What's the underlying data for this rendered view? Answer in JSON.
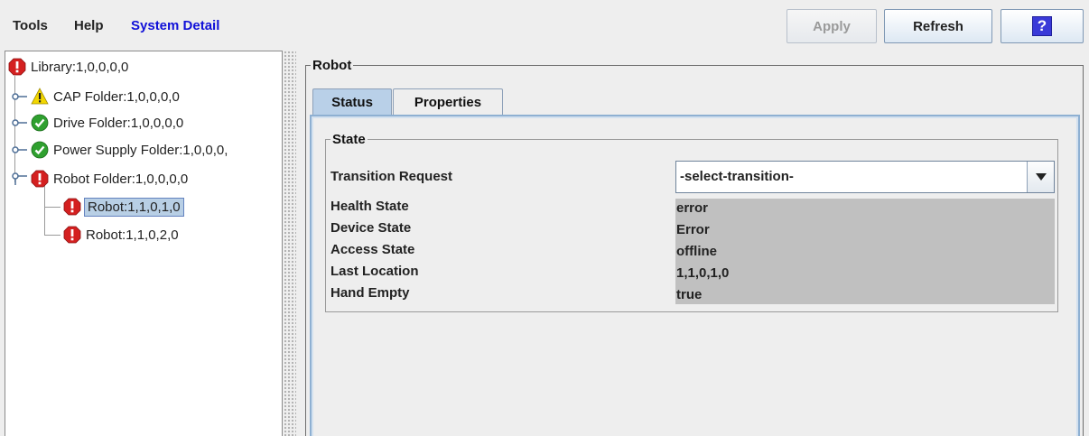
{
  "menu": {
    "tools": "Tools",
    "help": "Help",
    "system_detail": "System Detail"
  },
  "toolbar": {
    "apply_label": "Apply",
    "refresh_label": "Refresh",
    "help_glyph": "?"
  },
  "tree": {
    "items": [
      {
        "label": "Library:1,0,0,0,0",
        "icon": "error-icon"
      },
      {
        "label": "CAP Folder:1,0,0,0,0",
        "icon": "warning-icon"
      },
      {
        "label": "Drive Folder:1,0,0,0,0",
        "icon": "ok-icon"
      },
      {
        "label": "Power Supply Folder:1,0,0,0,",
        "icon": "ok-icon"
      },
      {
        "label": "Robot Folder:1,0,0,0,0",
        "icon": "error-icon"
      },
      {
        "label": "Robot:1,1,0,1,0",
        "icon": "error-icon",
        "selected": true
      },
      {
        "label": "Robot:1,1,0,2,0",
        "icon": "error-icon"
      }
    ]
  },
  "panel": {
    "title": "Robot",
    "tabs": [
      {
        "label": "Status",
        "active": true
      },
      {
        "label": "Properties",
        "active": false
      }
    ],
    "state_group_title": "State",
    "transition": {
      "label": "Transition Request",
      "selected": "-select-transition-"
    },
    "fields": [
      {
        "label": "Health State",
        "value": "error"
      },
      {
        "label": "Device State",
        "value": "Error"
      },
      {
        "label": "Access State",
        "value": "offline"
      },
      {
        "label": "Last Location",
        "value": "1,1,0,1,0"
      },
      {
        "label": "Hand Empty",
        "value": "true"
      }
    ]
  },
  "colors": {
    "error": "#d42020",
    "ok": "#2fa02f",
    "warning": "#f2d600",
    "link_blue": "#1010d8",
    "selection": "#b8cfe5"
  }
}
